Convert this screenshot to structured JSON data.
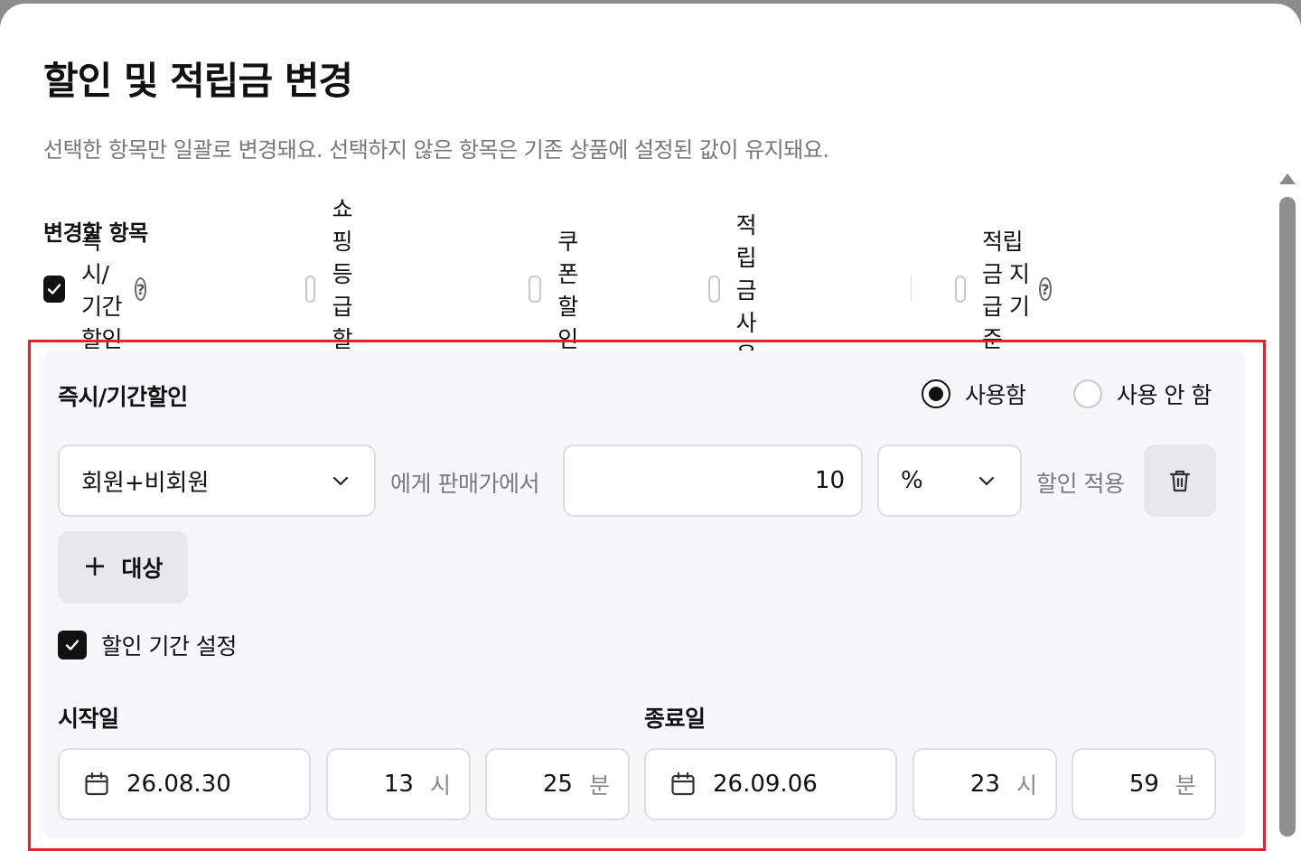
{
  "modal": {
    "title": "할인 및 적립금 변경",
    "description": "선택한 항목만 일괄로 변경돼요. 선택하지 않은 항목은 기존 상품에 설정된 값이 유지돼요."
  },
  "items_section": {
    "label": "변경할 항목",
    "options": [
      {
        "label": "즉시/기간할인",
        "checked": true,
        "help": "?"
      },
      {
        "label": "쇼핑등급 할인",
        "checked": false
      },
      {
        "label": "쿠폰 할인",
        "checked": false
      },
      {
        "label": "적립금 사용",
        "checked": false
      },
      {
        "label": "적립금 지급 기준",
        "checked": false,
        "help": "?"
      }
    ]
  },
  "discount_panel": {
    "title": "즉시/기간할인",
    "radio_use": "사용함",
    "radio_not_use": "사용 안 함",
    "selected_radio": "사용함",
    "target_select": "회원+비회원",
    "text_from_price": "에게 판매가에서",
    "amount": "10",
    "unit_select": "%",
    "text_apply": "할인 적용",
    "add_target_label": "대상",
    "period_checkbox_label": "할인 기간 설정",
    "period_checked": true,
    "start": {
      "label": "시작일",
      "date": "26.08.30",
      "hour": "13",
      "minute": "25"
    },
    "end": {
      "label": "종료일",
      "date": "26.09.06",
      "hour": "23",
      "minute": "59"
    },
    "hour_unit": "시",
    "minute_unit": "분"
  },
  "colors": {
    "highlight": "#e3222b",
    "checked": "#111111",
    "panel_bg": "#f6f7f9"
  }
}
